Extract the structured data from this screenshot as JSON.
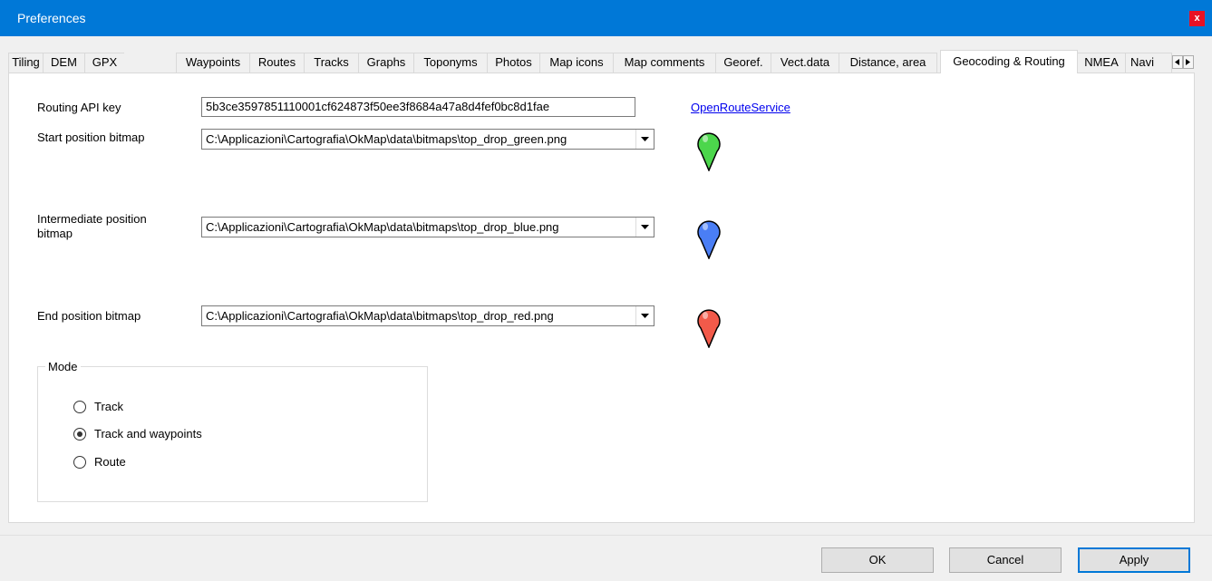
{
  "window": {
    "title": "Preferences",
    "close_label": "x"
  },
  "tabs": [
    {
      "label": "Tiling"
    },
    {
      "label": "DEM"
    },
    {
      "label": "GPX"
    },
    {
      "label": "Waypoints"
    },
    {
      "label": "Routes"
    },
    {
      "label": "Tracks"
    },
    {
      "label": "Graphs"
    },
    {
      "label": "Toponyms"
    },
    {
      "label": "Photos"
    },
    {
      "label": "Map icons"
    },
    {
      "label": "Map comments"
    },
    {
      "label": "Georef."
    },
    {
      "label": "Vect.data"
    },
    {
      "label": "Distance, area"
    },
    {
      "label": "Geocoding & Routing",
      "active": true
    },
    {
      "label": "NMEA"
    },
    {
      "label": "Navi"
    }
  ],
  "tab_scroll": {
    "left_icon": "triangle-left-icon",
    "right_icon": "triangle-right-icon"
  },
  "routing": {
    "api_key_label": "Routing API key",
    "api_key_value": "5b3ce3597851110001cf624873f50ee3f8684a47a8d4fef0bc8d1fae",
    "service_link": "OpenRouteService"
  },
  "bitmaps": {
    "start": {
      "label": "Start position bitmap",
      "value": "C:\\Applicazioni\\Cartografia\\OkMap\\data\\bitmaps\\top_drop_green.png",
      "pin_color": "#4cd64c"
    },
    "intermediate": {
      "label_line1": "Intermediate position",
      "label_line2": "bitmap",
      "value": "C:\\Applicazioni\\Cartografia\\OkMap\\data\\bitmaps\\top_drop_blue.png",
      "pin_color": "#4a7ef5"
    },
    "end": {
      "label": "End position bitmap",
      "value": "C:\\Applicazioni\\Cartografia\\OkMap\\data\\bitmaps\\top_drop_red.png",
      "pin_color": "#f25a4a"
    }
  },
  "mode": {
    "title": "Mode",
    "options": [
      {
        "label": "Track",
        "selected": false
      },
      {
        "label": "Track and waypoints",
        "selected": true
      },
      {
        "label": "Route",
        "selected": false
      }
    ]
  },
  "buttons": {
    "ok": "OK",
    "cancel": "Cancel",
    "apply": "Apply"
  }
}
